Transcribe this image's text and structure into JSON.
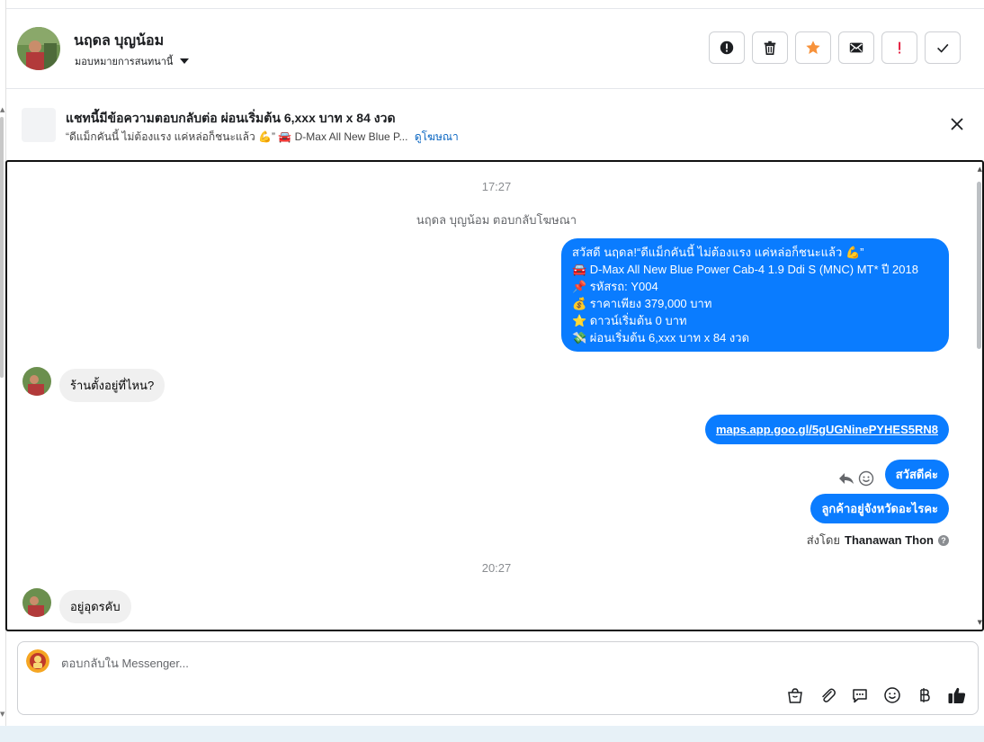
{
  "header": {
    "contact_name": "นฤดล บุญน้อม",
    "assign_label": "มอบหมายการสนทนานี้",
    "actions": [
      {
        "name": "spam-button",
        "icon": "exclamation-circle-icon"
      },
      {
        "name": "delete-button",
        "icon": "trash-icon"
      },
      {
        "name": "star-button",
        "icon": "star-icon"
      },
      {
        "name": "mark-unread-button",
        "icon": "envelope-icon"
      },
      {
        "name": "follow-up-button",
        "icon": "exclamation-icon"
      },
      {
        "name": "mark-done-button",
        "icon": "check-icon"
      }
    ]
  },
  "ad_banner": {
    "title": "แชทนี้มีข้อความตอบกลับต่อ ผ่อนเริ่มต้น 6,xxx บาท x 84 งวด",
    "subtitle_text": "“ดีแม็กคันนี้ ไม่ต้องแรง แค่หล่อก็ชนะแล้ว 💪” 🚘 D-Max All New Blue P...",
    "view_ad_link": "ดูโฆษณา"
  },
  "chat": {
    "time_1": "17:27",
    "system_note": "นฤดล บุญน้อม ตอบกลับโฆษณา",
    "ad_reply_lines": [
      "สวัสดี นฤดล!“ดีแม็กคันนี้ ไม่ต้องแรง แค่หล่อก็ชนะแล้ว 💪”",
      "🚘 D-Max All New Blue Power Cab-4 1.9 Ddi S (MNC) MT* ปี 2018",
      "📌 รหัสรถ: Y004",
      "💰 ราคาเพียง 379,000 บาท",
      "⭐ ดาวน์เริ่มต้น 0 บาท",
      "💸 ผ่อนเริ่มต้น 6,xxx บาท x 84 งวด"
    ],
    "incoming_1": "ร้านตั้งอยู่ที่ไหน?",
    "outgoing_link": "maps.app.goo.gl/5gUGNinePYHES5RN8",
    "outgoing_greeting": "สวัสดีค่ะ",
    "outgoing_question": "ลูกค้าอยู่จังหวัดอะไรคะ",
    "sent_by_prefix": "ส่งโดย",
    "sent_by_name": "Thanawan Thon",
    "time_2": "20:27",
    "incoming_2": "อยู่อุดรคับ"
  },
  "composer": {
    "placeholder": "ตอบกลับใน Messenger...",
    "tools": [
      "shopping-bag-icon",
      "paperclip-icon",
      "chat-bubble-icon",
      "smiley-icon",
      "baht-icon",
      "thumbs-up-icon"
    ]
  },
  "colors": {
    "accent_blue": "#0a7cff",
    "star_orange": "#f7923b",
    "alert_red": "#e41e3f",
    "incoming_bg": "#f0f0f0"
  }
}
